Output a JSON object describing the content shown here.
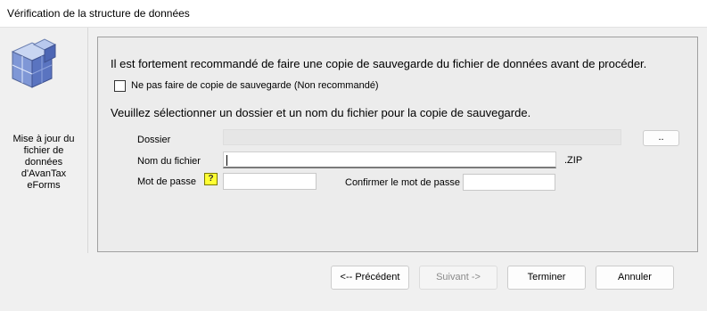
{
  "window": {
    "title": "Vérification de la structure de données"
  },
  "sidebar": {
    "icon": "cube-icon",
    "caption_lines": [
      "Mise à jour du",
      "fichier de",
      "données",
      "d'AvanTax",
      "eForms"
    ]
  },
  "main": {
    "warning_text": "Il est fortement recommandé de faire une copie de sauvegarde du fichier de données avant de procéder.",
    "skip_backup_label": "Ne pas faire de copie de sauvegarde (Non recommandé)",
    "skip_backup_checked": false,
    "select_text": "Veuillez sélectionner un dossier et un nom du fichier pour la copie de sauvegarde.",
    "folder_label": "Dossier",
    "folder_value": "",
    "browse_label": "..",
    "filename_label": "Nom du fichier",
    "filename_value": "",
    "extension_label": ".ZIP",
    "password_label": "Mot de passe",
    "help_label": "?",
    "password_value": "",
    "confirm_label": "Confirmer le mot de passe",
    "confirm_value": ""
  },
  "footer": {
    "prev_label": "<-- Précédent",
    "next_label": "Suivant ->",
    "finish_label": "Terminer",
    "cancel_label": "Annuler"
  }
}
